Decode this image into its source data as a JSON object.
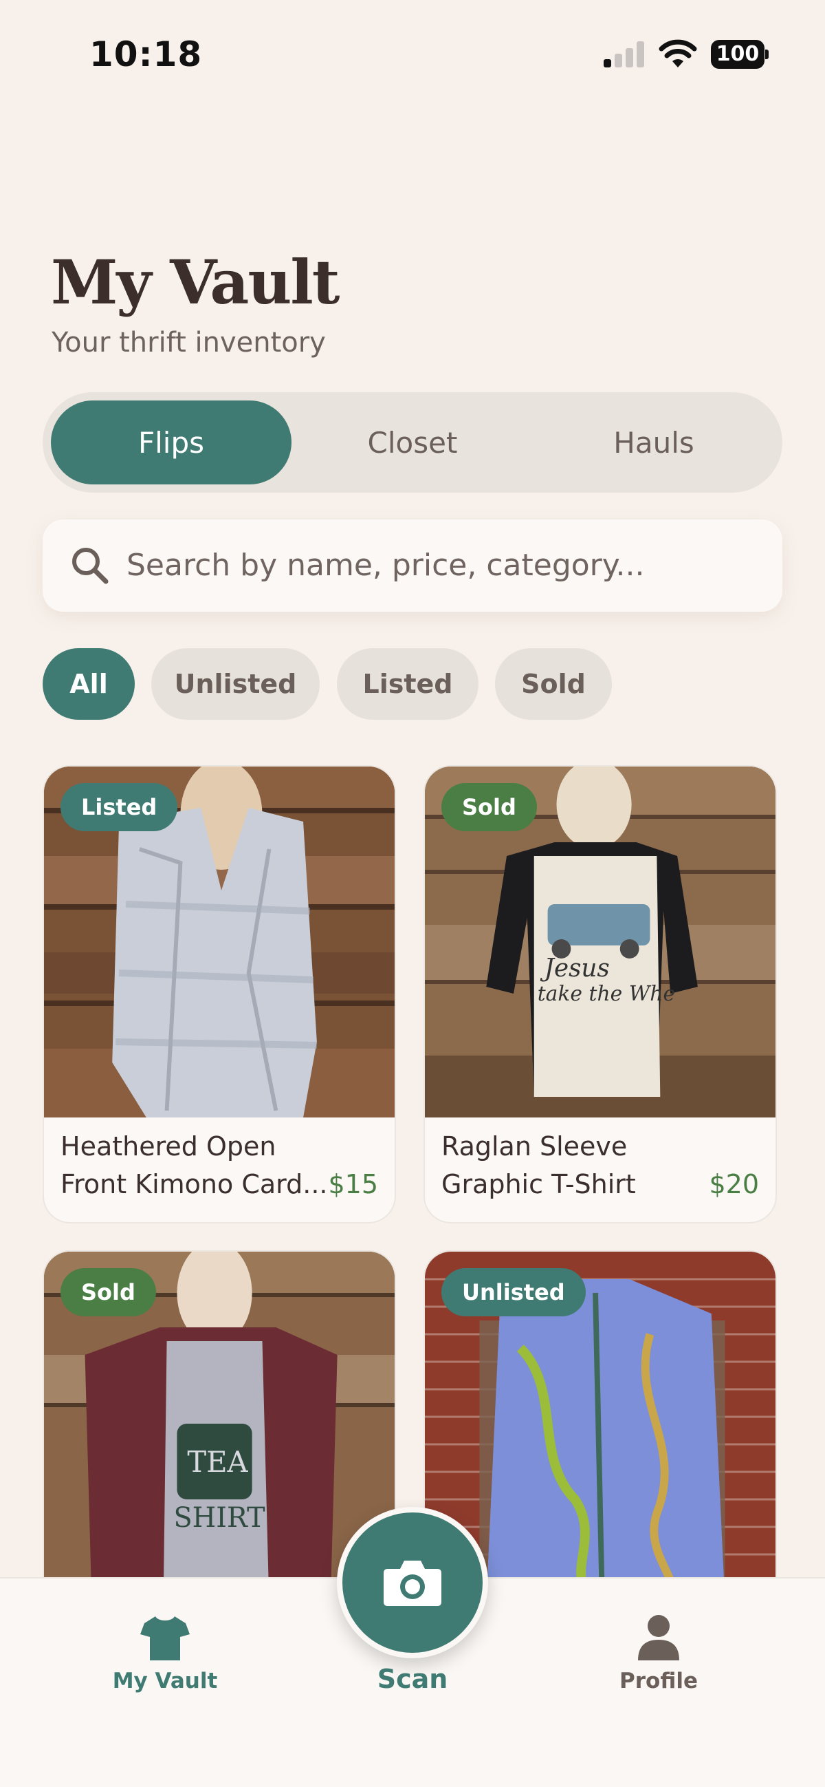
{
  "status_bar": {
    "time": "10:18",
    "battery": "100"
  },
  "header": {
    "title": "My Vault",
    "subtitle": "Your thrift inventory"
  },
  "tabs": [
    {
      "label": "Flips",
      "active": true
    },
    {
      "label": "Closet",
      "active": false
    },
    {
      "label": "Hauls",
      "active": false
    }
  ],
  "search": {
    "placeholder": "Search by name, price, category..."
  },
  "filters": [
    {
      "label": "All",
      "active": true
    },
    {
      "label": "Unlisted",
      "active": false
    },
    {
      "label": "Listed",
      "active": false
    },
    {
      "label": "Sold",
      "active": false
    }
  ],
  "items": [
    {
      "status": "Listed",
      "name_line1": "Heathered Open",
      "name_line2": "Front Kimono Card...",
      "price": "$15"
    },
    {
      "status": "Sold",
      "name_line1": "Raglan Sleeve",
      "name_line2": "Graphic T-Shirt",
      "price": "$20",
      "shirt_text_1": "Jesus",
      "shirt_text_2": "take the Whe"
    },
    {
      "status": "Sold",
      "shirt_text_1": "TEA",
      "shirt_text_2": "SHIRT"
    },
    {
      "status": "Unlisted"
    }
  ],
  "bottom_nav": {
    "vault": "My Vault",
    "scan": "Scan",
    "profile": "Profile"
  },
  "colors": {
    "accent": "#3f7b72",
    "sold": "#4a7e45",
    "background": "#f8f1eb"
  }
}
